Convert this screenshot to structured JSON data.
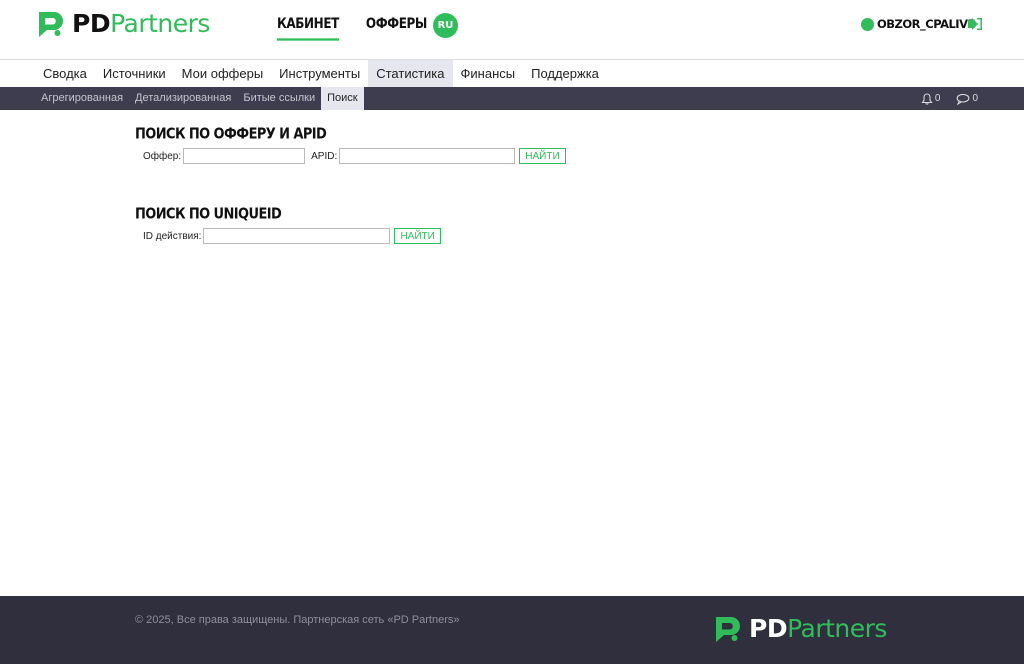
{
  "brand": {
    "pd": "PD",
    "partners": "Partners",
    "accent_color": "#2ebd59"
  },
  "header": {
    "nav": [
      {
        "label": "КАБИНЕТ",
        "active": true
      },
      {
        "label": "ОФФЕРЫ",
        "active": false
      }
    ],
    "lang": "RU",
    "username": "OBZOR_CPALIVE",
    "logout_icon": "logout-icon"
  },
  "main_menu": [
    {
      "label": "Сводка"
    },
    {
      "label": "Источники"
    },
    {
      "label": "Мои офферы"
    },
    {
      "label": "Инструменты"
    },
    {
      "label": "Статистика",
      "active": true
    },
    {
      "label": "Финансы"
    },
    {
      "label": "Поддержка"
    }
  ],
  "sub_menu": [
    {
      "label": "Агрегированная"
    },
    {
      "label": "Детализированная"
    },
    {
      "label": "Битые ссылки"
    },
    {
      "label": "Поиск",
      "active": true
    }
  ],
  "notifications": {
    "icon": "bell-icon",
    "count": "0"
  },
  "messages": {
    "icon": "chat-icon",
    "count": "0"
  },
  "search_offer": {
    "title": "ПОИСК ПО ОФФЕРУ И APID",
    "offer_label": "Оффер:",
    "offer_value": "",
    "apid_label": "APID:",
    "apid_value": "",
    "button": "НАЙТИ"
  },
  "search_uniqueid": {
    "title": "ПОИСК ПО UNIQUEID",
    "action_label": "ID действия:",
    "action_value": "",
    "button": "НАЙТИ"
  },
  "footer": {
    "copyright": "© 2025, Все права защищены. Партнерская сеть «PD Partners»"
  }
}
